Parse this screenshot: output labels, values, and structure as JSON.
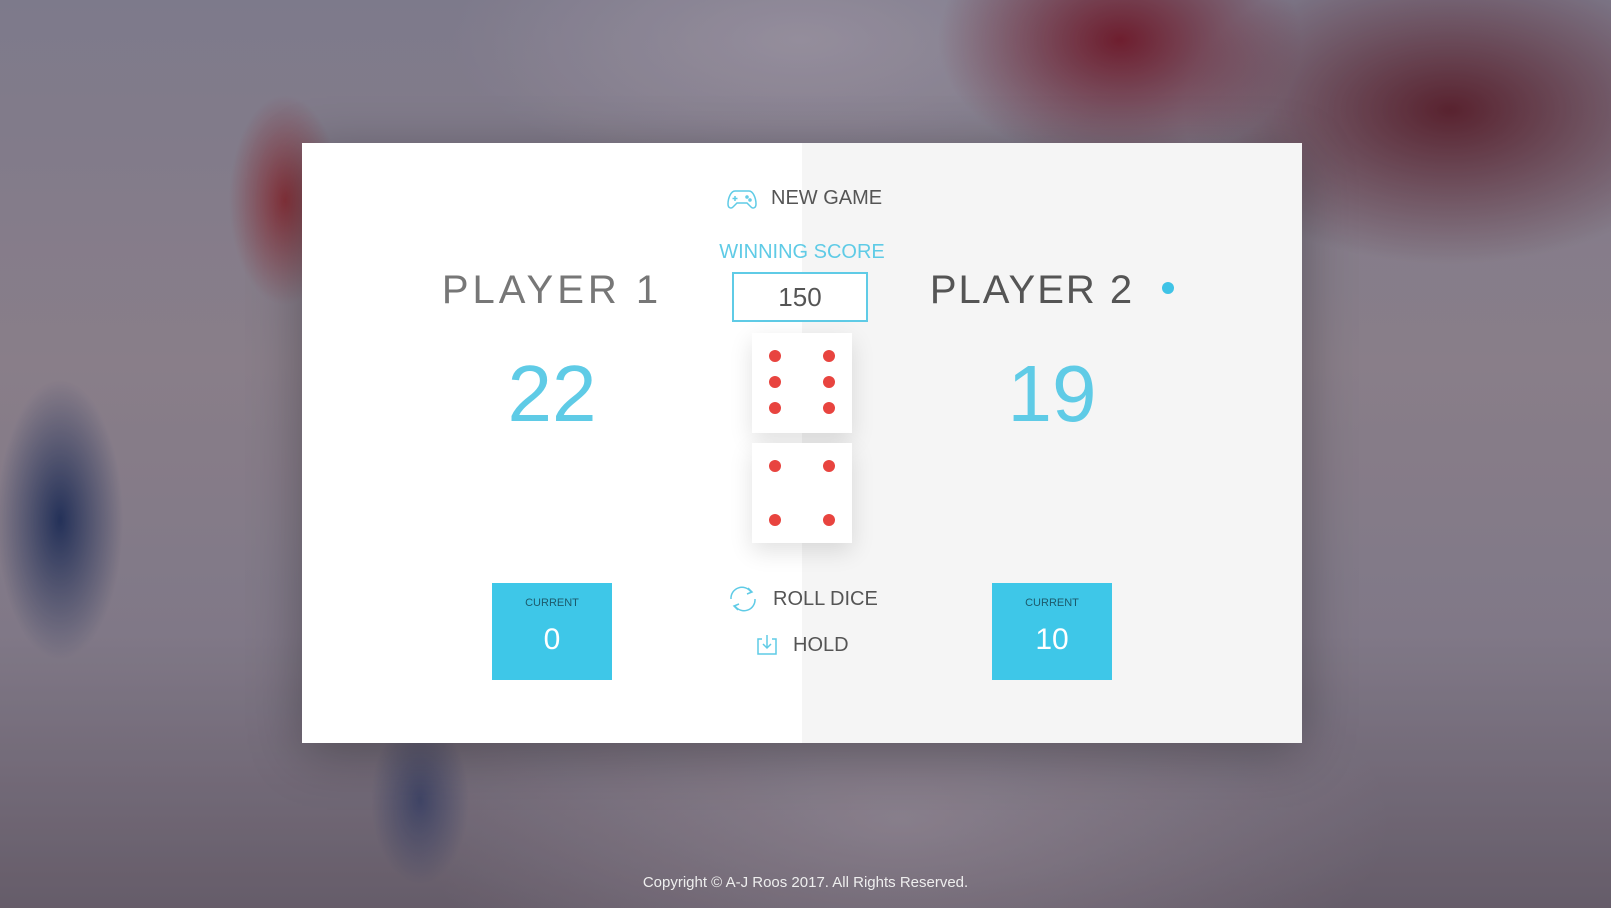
{
  "header": {
    "new_game_label": "NEW GAME",
    "new_game_icon": "gamepad-icon",
    "winning_score_label": "WINNING SCORE",
    "winning_score_value": "150"
  },
  "players": [
    {
      "name": "PLAYER 1",
      "score": "22",
      "current_label": "CURRENT",
      "current_score": "0",
      "active": false
    },
    {
      "name": "PLAYER 2",
      "score": "19",
      "current_label": "CURRENT",
      "current_score": "10",
      "active": true
    }
  ],
  "dice": [
    {
      "value": 6
    },
    {
      "value": 4
    }
  ],
  "controls": {
    "roll_label": "ROLL DICE",
    "roll_icon": "refresh-icon",
    "hold_label": "HOLD",
    "hold_icon": "download-icon"
  },
  "colors": {
    "accent": "#3fc3e6",
    "pip": "#e8443f",
    "current_box": "#3ec7e8"
  },
  "footer": {
    "copyright": "Copyright © A-J Roos 2017. All Rights Reserved."
  }
}
